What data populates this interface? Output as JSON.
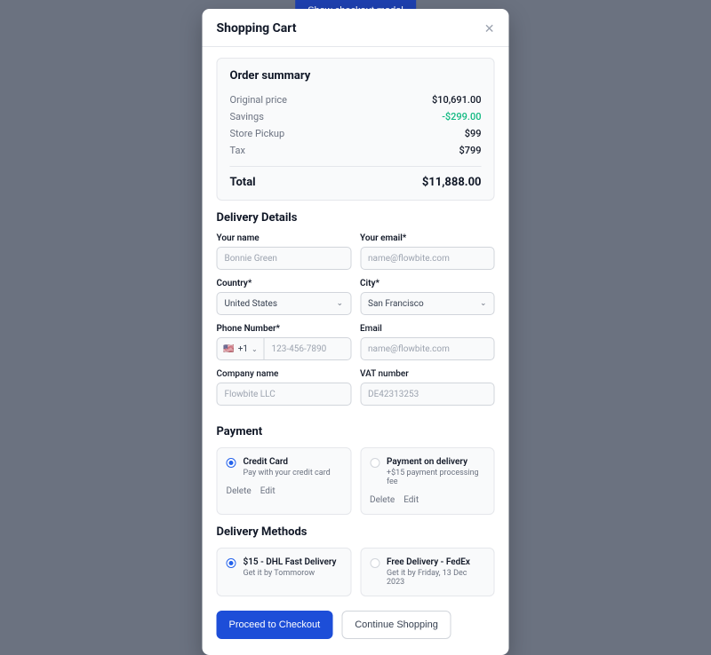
{
  "background_button": "Show checkout modal",
  "modal": {
    "title": "Shopping Cart"
  },
  "summary": {
    "heading": "Order summary",
    "rows": {
      "original_label": "Original price",
      "original_value": "$10,691.00",
      "savings_label": "Savings",
      "savings_value": "-$299.00",
      "pickup_label": "Store Pickup",
      "pickup_value": "$99",
      "tax_label": "Tax",
      "tax_value": "$799"
    },
    "total_label": "Total",
    "total_value": "$11,888.00"
  },
  "delivery": {
    "heading": "Delivery Details",
    "name_label": "Your name",
    "name_placeholder": "Bonnie Green",
    "email_label": "Your email*",
    "email_placeholder": "name@flowbite.com",
    "country_label": "Country*",
    "country_value": "United States",
    "city_label": "City*",
    "city_value": "San Francisco",
    "phone_label": "Phone Number*",
    "phone_code": "+1",
    "phone_placeholder": "123-456-7890",
    "email2_label": "Email",
    "email2_placeholder": "name@flowbite.com",
    "company_label": "Company name",
    "company_placeholder": "Flowbite LLC",
    "vat_label": "VAT number",
    "vat_placeholder": "DE42313253"
  },
  "payment": {
    "heading": "Payment",
    "credit_title": "Credit Card",
    "credit_sub": "Pay with your credit card",
    "cod_title": "Payment on delivery",
    "cod_sub": "+$15 payment processing fee",
    "delete": "Delete",
    "edit": "Edit"
  },
  "methods": {
    "heading": "Delivery Methods",
    "dhl_title": "$15 - DHL Fast Delivery",
    "dhl_sub": "Get it by Tommorow",
    "fedex_title": "Free Delivery - FedEx",
    "fedex_sub": "Get it by Friday, 13 Dec 2023"
  },
  "buttons": {
    "checkout": "Proceed to Checkout",
    "continue": "Continue Shopping"
  }
}
